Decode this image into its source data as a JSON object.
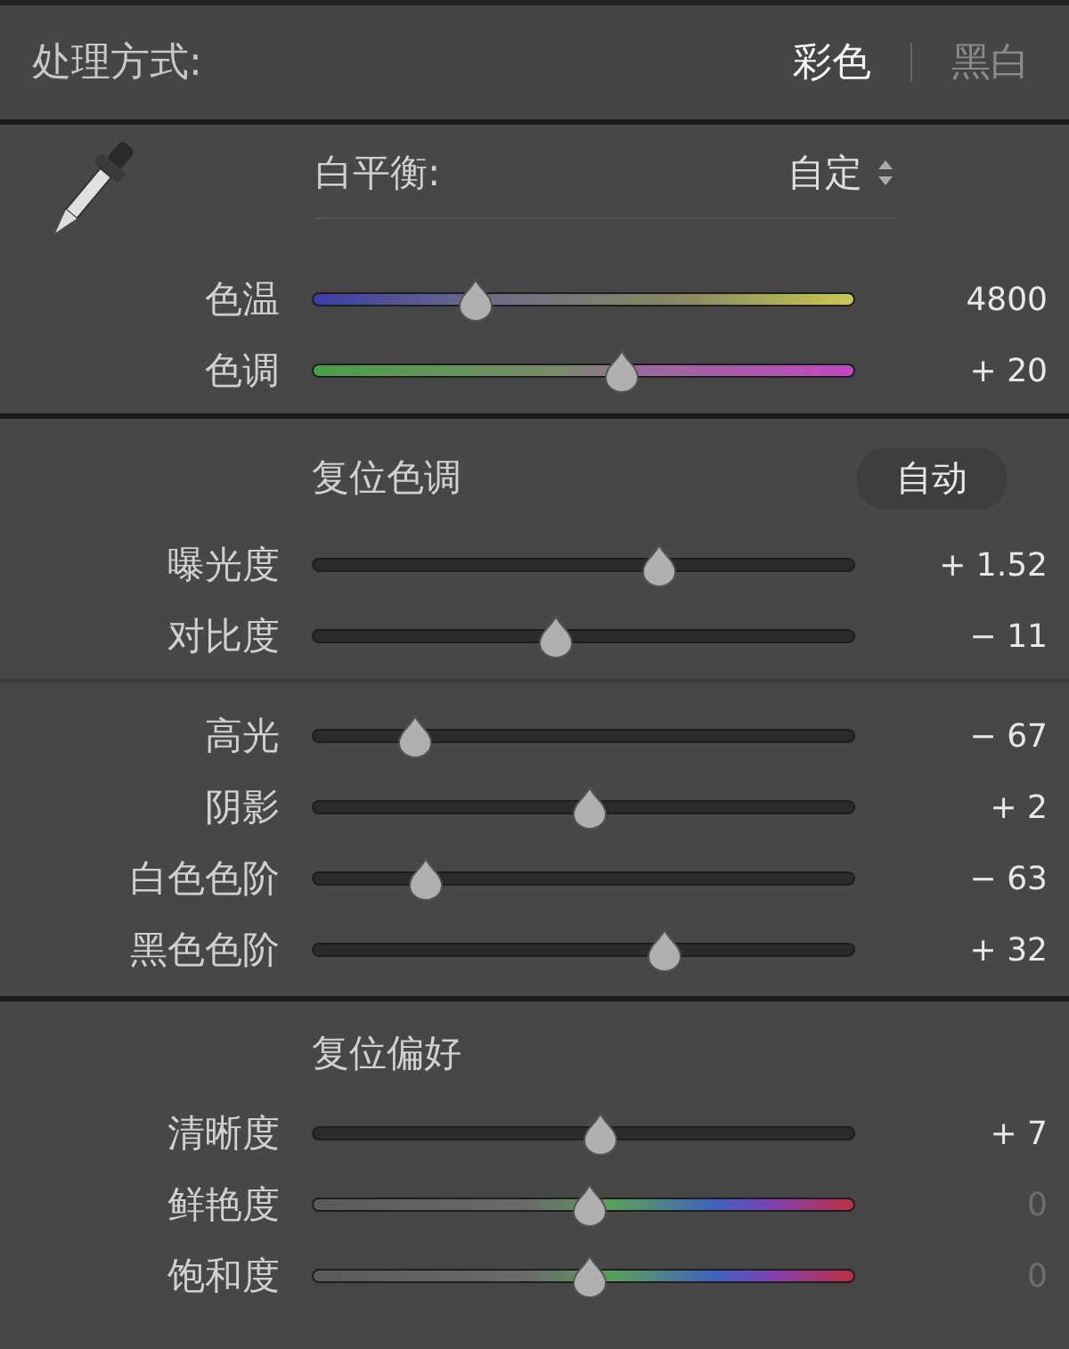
{
  "treatment": {
    "label": "处理方式:",
    "options": [
      {
        "label": "彩色",
        "selected": true
      },
      {
        "label": "黑白",
        "selected": false
      }
    ]
  },
  "white_balance": {
    "label": "白平衡:",
    "preset": "自定",
    "sliders": [
      {
        "label": "色温",
        "kind": "temperature",
        "level": 0.3,
        "reading": "4800",
        "dimmed": false
      },
      {
        "label": "色调",
        "kind": "tint",
        "level": 0.57,
        "reading": "+ 20",
        "dimmed": false
      }
    ]
  },
  "tone": {
    "reset": "复位色调",
    "auto_button": "自动",
    "groups": [
      [
        {
          "label": "曝光度",
          "kind": "plain",
          "level": 0.64,
          "reading": "+ 1.52",
          "dimmed": false
        },
        {
          "label": "对比度",
          "kind": "plain",
          "level": 0.45,
          "reading": "− 11",
          "dimmed": false
        }
      ],
      [
        {
          "label": "高光",
          "kind": "plain",
          "level": 0.19,
          "reading": "− 67",
          "dimmed": false
        },
        {
          "label": "阴影",
          "kind": "plain",
          "level": 0.51,
          "reading": "+ 2",
          "dimmed": false
        },
        {
          "label": "白色色阶",
          "kind": "plain",
          "level": 0.21,
          "reading": "− 63",
          "dimmed": false
        },
        {
          "label": "黑色色阶",
          "kind": "plain",
          "level": 0.65,
          "reading": "+ 32",
          "dimmed": false
        }
      ]
    ]
  },
  "presence": {
    "reset": "复位偏好",
    "sliders": [
      {
        "label": "清晰度",
        "kind": "plain",
        "level": 0.53,
        "reading": "+ 7",
        "dimmed": false
      },
      {
        "label": "鲜艳度",
        "kind": "saturation",
        "level": 0.51,
        "reading": "0",
        "dimmed": true
      },
      {
        "label": "饱和度",
        "kind": "saturation",
        "level": 0.51,
        "reading": "0",
        "dimmed": true
      }
    ]
  }
}
